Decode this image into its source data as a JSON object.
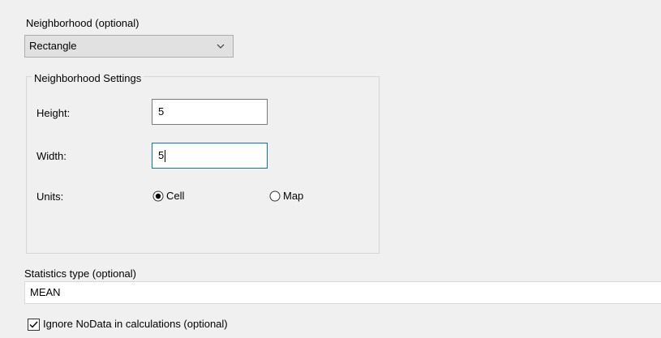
{
  "neighborhood": {
    "label": "Neighborhood (optional)",
    "selected": "Rectangle"
  },
  "settings": {
    "title": "Neighborhood Settings",
    "height_label": "Height:",
    "height_value": "5",
    "width_label": "Width:",
    "width_value": "5",
    "units_label": "Units:",
    "units_options": [
      "Cell",
      "Map"
    ],
    "units_selected": "Cell"
  },
  "statistics": {
    "label": "Statistics type (optional)",
    "value": "MEAN"
  },
  "ignore_nodata": {
    "label": "Ignore NoData in calculations (optional)",
    "checked": true
  },
  "colors": {
    "background": "#f0f0f0",
    "focus_border": "#0078d7",
    "input_border": "#7a7a7a",
    "dropdown_bg": "#e1e1e1"
  }
}
